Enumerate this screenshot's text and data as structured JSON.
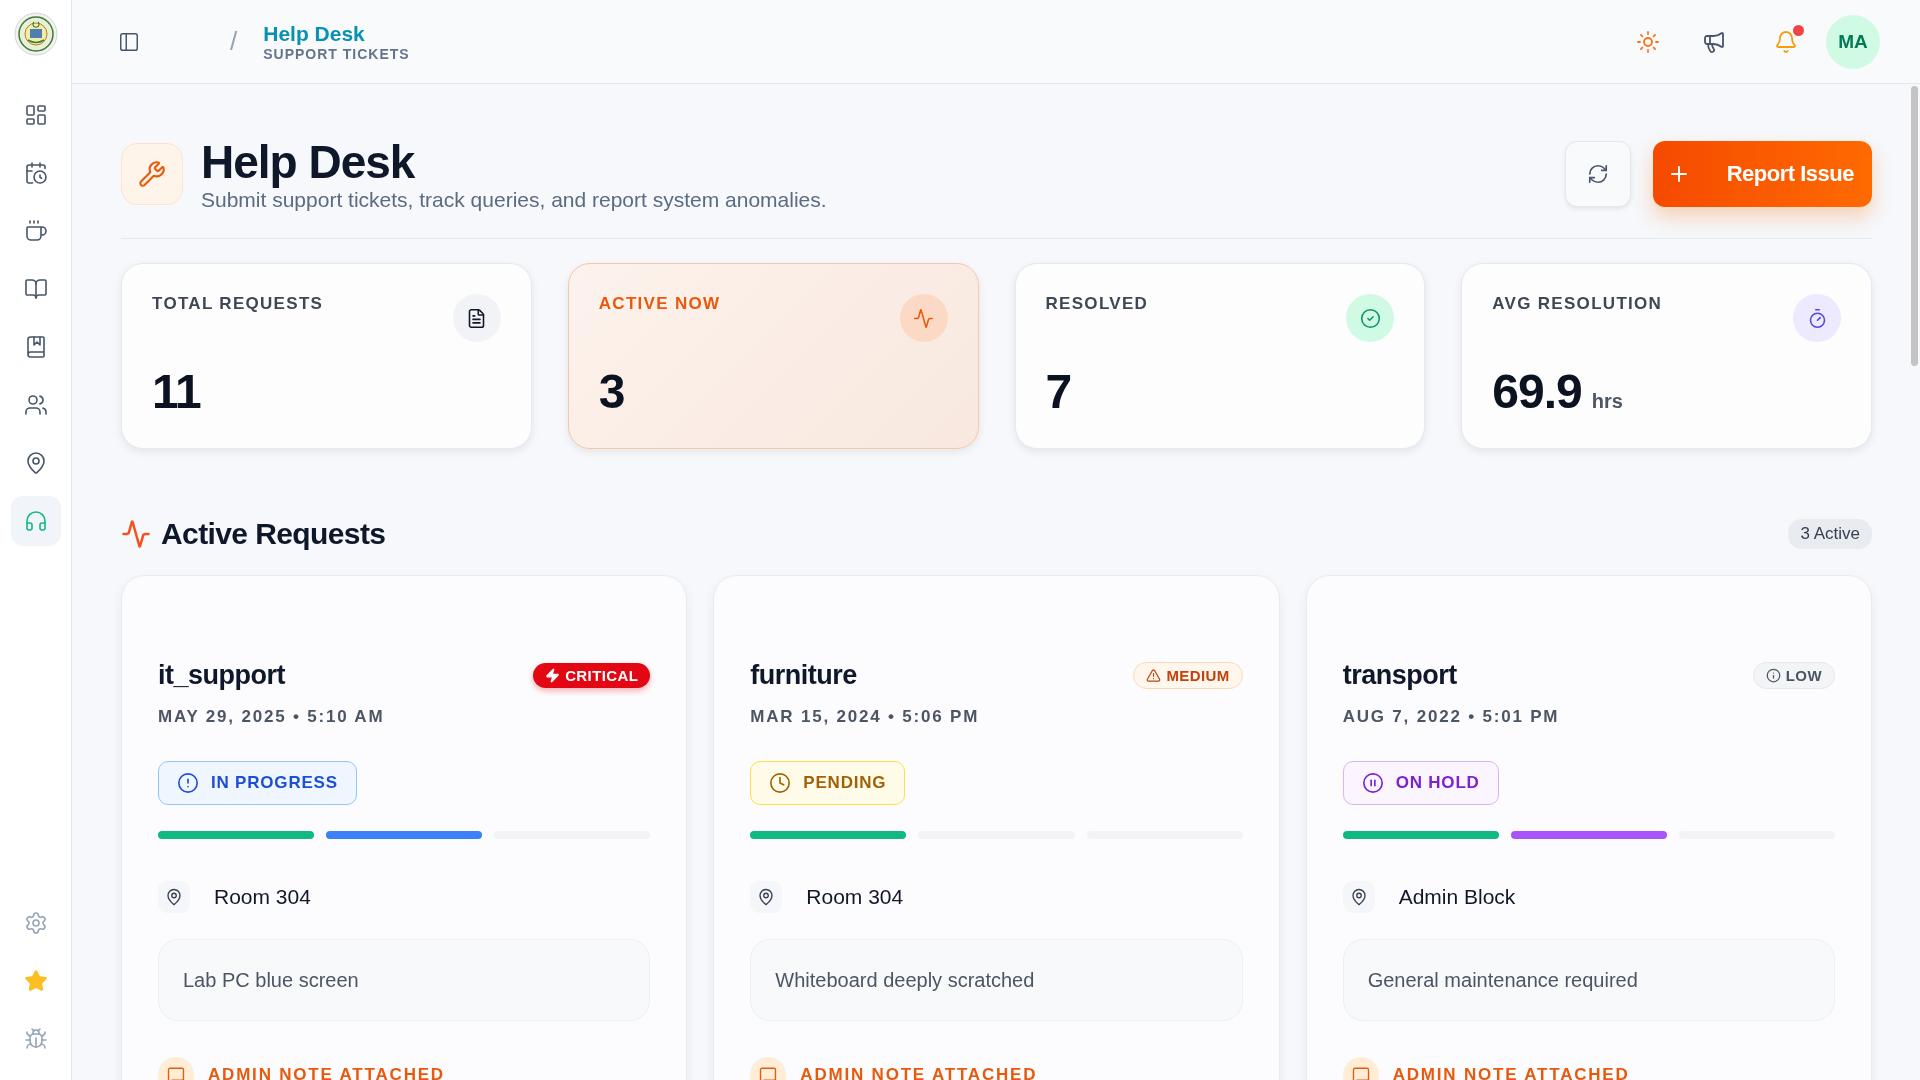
{
  "sidebar": {
    "items": [
      {
        "selected": false
      },
      {
        "selected": false
      },
      {
        "selected": false
      },
      {
        "selected": false
      },
      {
        "selected": false
      },
      {
        "selected": false
      },
      {
        "selected": false
      },
      {
        "selected": true
      }
    ]
  },
  "header": {
    "breadcrumb_separator": "/",
    "breadcrumb_title": "Help Desk",
    "breadcrumb_subtitle": "SUPPORT TICKETS",
    "notification_unread": true,
    "avatar": "MA"
  },
  "page": {
    "title": "Help Desk",
    "subtitle": "Submit support tickets, track queries, and report system anomalies.",
    "primary_button": "Report Issue"
  },
  "stats": [
    {
      "kind": "total",
      "label": "TOTAL REQUESTS",
      "value": "11",
      "selected": false
    },
    {
      "kind": "active",
      "label": "ACTIVE NOW",
      "value": "3",
      "selected": true
    },
    {
      "kind": "resolved",
      "label": "RESOLVED",
      "value": "7",
      "selected": false
    },
    {
      "kind": "time",
      "label": "AVG RESOLUTION",
      "value": "69.9",
      "unit": "hrs",
      "selected": false
    }
  ],
  "active_requests": {
    "title": "Active Requests",
    "count_badge": "3 Active",
    "tickets": [
      {
        "category": "it_support",
        "date": "MAY 29, 2025 • 5:10 AM",
        "priority": {
          "kind": "critical",
          "label": "CRITICAL"
        },
        "status": {
          "kind": "in_progress",
          "label": "IN PROGRESS"
        },
        "steps": [
          {
            "filled": true
          },
          {
            "filled": true
          },
          {
            "filled": false
          }
        ],
        "location": "Room 304",
        "description": "Lab PC blue screen",
        "note": "ADMIN NOTE ATTACHED"
      },
      {
        "category": "furniture",
        "date": "MAR 15, 2024 • 5:06 PM",
        "priority": {
          "kind": "medium",
          "label": "MEDIUM"
        },
        "status": {
          "kind": "pending",
          "label": "PENDING"
        },
        "steps": [
          {
            "filled": true
          },
          {
            "filled": false
          },
          {
            "filled": false
          }
        ],
        "location": "Room 304",
        "description": "Whiteboard deeply scratched",
        "note": "ADMIN NOTE ATTACHED"
      },
      {
        "category": "transport",
        "date": "AUG 7, 2022 • 5:01 PM",
        "priority": {
          "kind": "low",
          "label": "LOW"
        },
        "status": {
          "kind": "on_hold",
          "label": "ON HOLD"
        },
        "steps": [
          {
            "filled": true
          },
          {
            "filled": true
          },
          {
            "filled": false
          }
        ],
        "location": "Admin Block",
        "description": "General maintenance required",
        "note": "ADMIN NOTE ATTACHED"
      }
    ]
  }
}
